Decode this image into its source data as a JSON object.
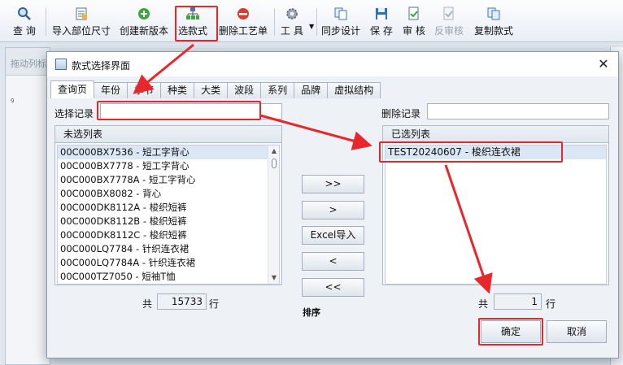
{
  "toolbar": {
    "items": [
      {
        "label": "查 询",
        "icon": "magnifier-icon"
      },
      {
        "label": "导入部位尺寸",
        "icon": "ruler-sheet-icon"
      },
      {
        "label": "创建新版本",
        "icon": "green-plus-icon"
      },
      {
        "label": "选款式",
        "icon": "tree-nodes-icon"
      },
      {
        "label": "删除工艺单",
        "icon": "red-minus-icon"
      },
      {
        "label": "工 具",
        "icon": "gear-icon"
      },
      {
        "label": "同步设计",
        "icon": "sync-docs-icon"
      },
      {
        "label": "保 存",
        "icon": "floppy-icon"
      },
      {
        "label": "审 核",
        "icon": "approve-doc-icon"
      },
      {
        "label": "反审核",
        "icon": "unapprove-doc-icon"
      },
      {
        "label": "复制款式",
        "icon": "copy-doc-icon"
      }
    ],
    "highlight_color": "#e8272b"
  },
  "background": {
    "left_panel_header": "拖动列标",
    "pin": "ꝰ"
  },
  "dialog": {
    "title": "款式选择界面",
    "close_glyph": "✕",
    "tabs": [
      "查询页",
      "年份",
      "季节",
      "种类",
      "大类",
      "波段",
      "系列",
      "品牌",
      "虚拟结构"
    ],
    "select_label": "选择记录",
    "select_value": "",
    "delete_label": "删除记录",
    "delete_value": "",
    "unselected_header": "未选列表",
    "unselected_items": [
      "00C000BX7536 - 短工字背心",
      "00C000BX7778 - 短工字背心",
      "00C000BX7778A - 短工字背心",
      "00C000BX8082 - 背心",
      "00C000DK8112A - 梭织短裤",
      "00C000DK8112B - 梭织短裤",
      "00C000DK8112C - 梭织短裤",
      "00C000LQ7784 - 针织连衣裙",
      "00C000LQ7784A - 针织连衣裙",
      "00C000TZ7050 - 短袖T恤"
    ],
    "selected_header": "已选列表",
    "selected_items": [
      "TEST20240607 - 梭织连衣裙"
    ],
    "buttons": {
      "add_all": ">>",
      "add": ">",
      "excel": "Excel导入",
      "remove": "<",
      "remove_all": "<<",
      "ok": "确定",
      "cancel": "取消"
    },
    "total_prefix": "共",
    "total_suffix": "行",
    "unselected_count": "15733",
    "selected_count": "1",
    "sort_label": "排序"
  }
}
